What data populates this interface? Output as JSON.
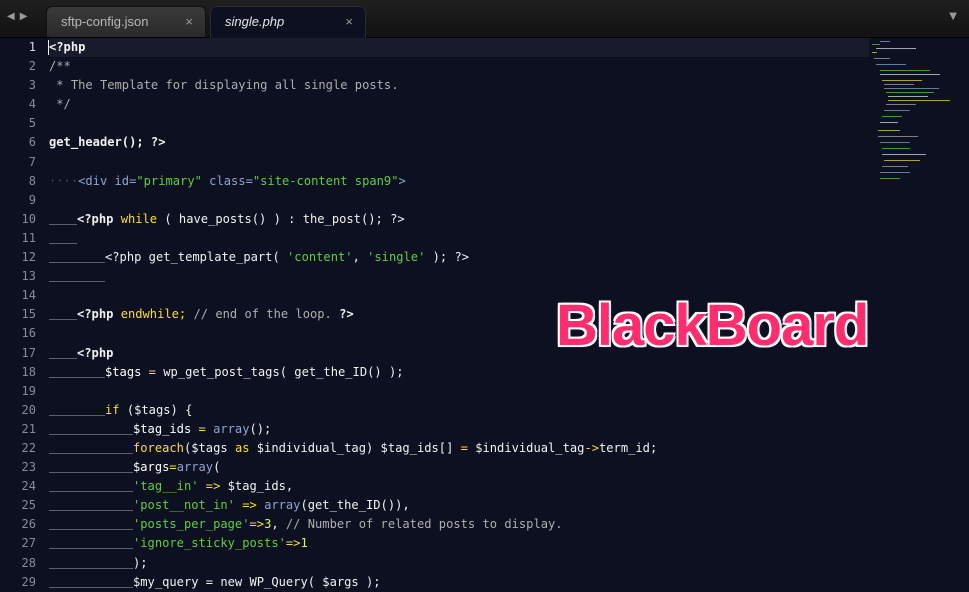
{
  "tabs": [
    {
      "label": "sftp-config.json",
      "close": "×",
      "active": false
    },
    {
      "label": "single.php",
      "close": "×",
      "active": true
    }
  ],
  "nav": {
    "back": "◀",
    "forward": "▶",
    "menu": "▼"
  },
  "line_numbers": [
    "1",
    "2",
    "3",
    "4",
    "5",
    "6",
    "7",
    "8",
    "9",
    "10",
    "11",
    "12",
    "13",
    "14",
    "15",
    "16",
    "17",
    "18",
    "19",
    "20",
    "21",
    "22",
    "23",
    "24",
    "25",
    "26",
    "27",
    "28",
    "29"
  ],
  "code": {
    "l1": {
      "a": "<?php"
    },
    "l2": {
      "a": "/**"
    },
    "l3": {
      "a": " * The Template for displaying all single posts."
    },
    "l4": {
      "a": " */"
    },
    "l6": {
      "a": "get_header();",
      "b": " ?>"
    },
    "l8": {
      "dots": "····",
      "a": "<div ",
      "b": "id=",
      "c": "\"primary\"",
      "d": " class=",
      "e": "\"site-content span9\"",
      "f": ">"
    },
    "l10": {
      "a": "<?php ",
      "b": "while",
      "c": " ( have_posts() ) : the_post(); ?>"
    },
    "l12": {
      "a": "<?php get_template_part( ",
      "b": "'content'",
      "c": ", ",
      "d": "'single'",
      "e": " ); ?>"
    },
    "l15": {
      "a": "<?php ",
      "b": "endwhile;",
      "c": " // end of the loop.",
      "d": " ?>"
    },
    "l17": {
      "a": "<?php"
    },
    "l18": {
      "a": "$tags",
      " b": "",
      "op": " = ",
      "c": "wp_get_post_tags( get_the_ID() );"
    },
    "l20": {
      "a": "if",
      "b": " ($tags) {"
    },
    "l21": {
      "a": "$tag_ids",
      "op": " = ",
      "b": "array",
      "c": "();"
    },
    "l22": {
      "a": "foreach",
      "b": "($tags ",
      "c": "as",
      "d": " $individual_tag) $tag_ids[] ",
      "op": "=",
      "e": " $individual_tag",
      "f": "->",
      "g": "term_id;"
    },
    "l23": {
      "a": "$args",
      "op": "=",
      "b": "array",
      "c": "("
    },
    "l24": {
      "a": "'tag__in'",
      "op": " => ",
      "b": "$tag_ids,"
    },
    "l25": {
      "a": "'post__not_in'",
      "op": " => ",
      "b": "array",
      "c": "(get_the_ID()),"
    },
    "l26": {
      "a": "'posts_per_page'",
      "op": "=>",
      "b": "3",
      "c": ",",
      "d": " // Number of related posts to display."
    },
    "l27": {
      "a": "'ignore_sticky_posts'",
      "op": "=>",
      "b": "1"
    },
    "l28": {
      "a": ");"
    },
    "l29": {
      "a": "$my_query = new WP_Query( $args );"
    }
  },
  "brand": "BlackBoard",
  "colors": {
    "background": "#0c1021",
    "keyword": "#fbde2d",
    "string": "#61ce3c",
    "comment": "#aeaeae",
    "attribute": "#8da6ce",
    "brand": "#ff2d6d"
  }
}
